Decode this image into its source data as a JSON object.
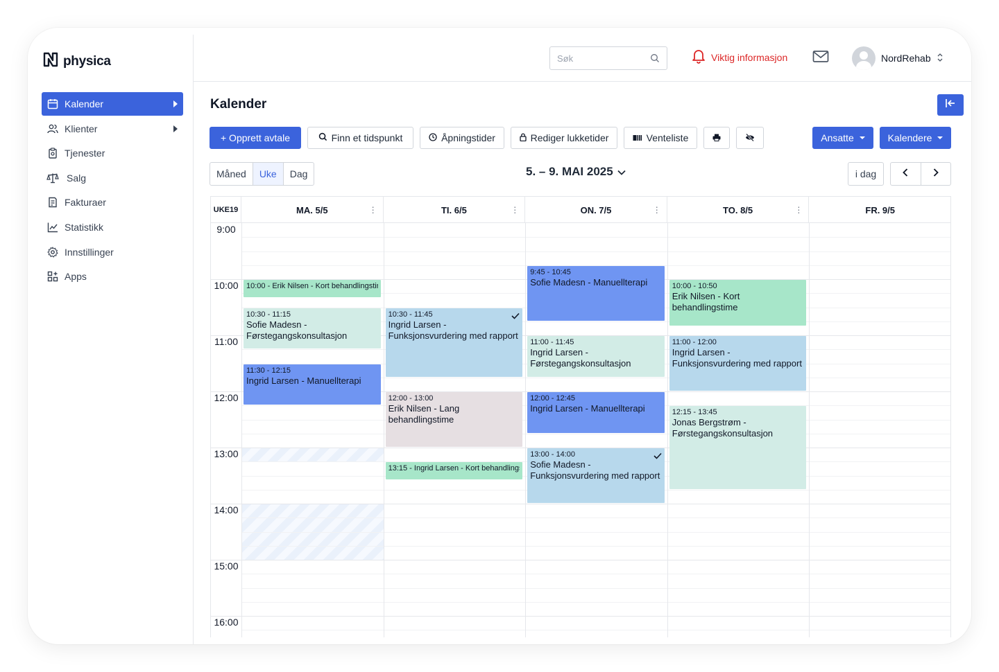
{
  "brand": {
    "name": "physica"
  },
  "sidebar": {
    "items": [
      {
        "label": "Kalender",
        "icon": "calendar-icon",
        "active": true,
        "expandable": true
      },
      {
        "label": "Klienter",
        "icon": "users-icon",
        "active": false,
        "expandable": true
      },
      {
        "label": "Tjenester",
        "icon": "clipboard-icon",
        "active": false,
        "expandable": false
      },
      {
        "label": "Salg",
        "icon": "scale-icon",
        "active": false,
        "expandable": false
      },
      {
        "label": "Fakturaer",
        "icon": "invoice-icon",
        "active": false,
        "expandable": false
      },
      {
        "label": "Statistikk",
        "icon": "chart-icon",
        "active": false,
        "expandable": false
      },
      {
        "label": "Innstillinger",
        "icon": "gear-icon",
        "active": false,
        "expandable": false
      },
      {
        "label": "Apps",
        "icon": "apps-icon",
        "active": false,
        "expandable": false
      }
    ]
  },
  "topbar": {
    "search_placeholder": "Søk",
    "notice": "Viktig informasjon",
    "user": "NordRehab"
  },
  "main": {
    "title": "Kalender",
    "toolbar": {
      "create": "+ Opprett avtale",
      "find": "Finn et tidspunkt",
      "opening": "Åpningstider",
      "closed": "Rediger lukketider",
      "waitlist": "Venteliste",
      "staff": "Ansatte",
      "calendars": "Kalendere"
    },
    "views": [
      "Måned",
      "Uke",
      "Dag"
    ],
    "active_view": "Uke",
    "date_range": "5. – 9. MAI 2025",
    "today": "i dag"
  },
  "calendar": {
    "week_label": "UKE19",
    "days": [
      "MA. 5/5",
      "TI. 6/5",
      "ON. 7/5",
      "TO. 8/5",
      "FR. 9/5"
    ],
    "hours": [
      "9:00",
      "10:00",
      "11:00",
      "12:00",
      "13:00",
      "14:00",
      "15:00",
      "16:00"
    ],
    "events": [
      {
        "day": 0,
        "start": "10:00",
        "end": "10:20",
        "time": "10:00",
        "title": "Erik Nilsen - Kort behandlingstime",
        "color": "#a7e6c9",
        "single_line": true
      },
      {
        "day": 0,
        "start": "10:30",
        "end": "11:15",
        "time": "10:30 - 11:15",
        "title": "Sofie Madesn - Førstegangskonsultasjon",
        "color": "#d2ece6"
      },
      {
        "day": 0,
        "start": "11:30",
        "end": "12:15",
        "time": "11:30 - 12:15",
        "title": "Ingrid Larsen - Manuellterapi",
        "color": "#6f95f2"
      },
      {
        "day": 1,
        "start": "10:30",
        "end": "11:45",
        "time": "10:30 - 11:45",
        "title": "Ingrid Larsen - Funksjonsvurdering med rapport",
        "color": "#b7d8ec",
        "checked": true
      },
      {
        "day": 1,
        "start": "12:00",
        "end": "13:00",
        "time": "12:00 - 13:00",
        "title": "Erik Nilsen - Lang behandlingstime",
        "color": "#e6dfe2"
      },
      {
        "day": 1,
        "start": "13:15",
        "end": "13:35",
        "time": "13:15",
        "title": "Ingrid Larsen - Kort behandlingstime",
        "color": "#a7e6c9",
        "single_line": true
      },
      {
        "day": 2,
        "start": "9:45",
        "end": "10:45",
        "time": "9:45 - 10:45",
        "title": "Sofie Madesn - Manuellterapi",
        "color": "#6f95f2"
      },
      {
        "day": 2,
        "start": "11:00",
        "end": "11:45",
        "time": "11:00 - 11:45",
        "title": "Ingrid Larsen - Førstegangskonsultasjon",
        "color": "#d2ece6"
      },
      {
        "day": 2,
        "start": "12:00",
        "end": "12:45",
        "time": "12:00 - 12:45",
        "title": "Ingrid Larsen - Manuellterapi",
        "color": "#6f95f2"
      },
      {
        "day": 2,
        "start": "13:00",
        "end": "14:00",
        "time": "13:00 - 14:00",
        "title": "Sofie Madesn - Funksjonsvurdering med rapport",
        "color": "#b7d8ec",
        "checked": true
      },
      {
        "day": 3,
        "start": "10:00",
        "end": "10:50",
        "time": "10:00 - 10:50",
        "title": "Erik Nilsen - Kort behandlingstime",
        "color": "#a7e6c9"
      },
      {
        "day": 3,
        "start": "11:00",
        "end": "12:00",
        "time": "11:00 - 12:00",
        "title": "Ingrid Larsen - Funksjonsvurdering med rapport",
        "color": "#b7d8ec"
      },
      {
        "day": 3,
        "start": "12:15",
        "end": "13:45",
        "time": "12:15 - 13:45",
        "title": "Jonas Bergstrøm - Førstegangskonsultasjon",
        "color": "#d2ece6"
      }
    ],
    "blocked": [
      {
        "day": 0,
        "start": "13:00",
        "end": "13:15"
      },
      {
        "day": 0,
        "start": "14:00",
        "end": "15:00"
      }
    ]
  },
  "colors": {
    "accent": "#3b63dc",
    "notice": "#dc2626"
  }
}
